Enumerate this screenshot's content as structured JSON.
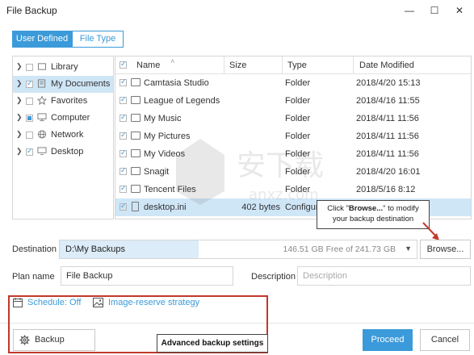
{
  "window": {
    "title": "File Backup"
  },
  "tabs": [
    {
      "label": "User Defined",
      "active": true
    },
    {
      "label": "File Type",
      "active": false
    }
  ],
  "tree": [
    {
      "label": "Library",
      "checked": false,
      "partial": false,
      "selected": false,
      "icon": "library-icon"
    },
    {
      "label": "My Documents",
      "checked": true,
      "partial": false,
      "selected": true,
      "icon": "documents-icon"
    },
    {
      "label": "Favorites",
      "checked": false,
      "partial": false,
      "selected": false,
      "icon": "star-icon"
    },
    {
      "label": "Computer",
      "checked": false,
      "partial": true,
      "selected": false,
      "icon": "computer-icon"
    },
    {
      "label": "Network",
      "checked": false,
      "partial": false,
      "selected": false,
      "icon": "network-icon"
    },
    {
      "label": "Desktop",
      "checked": true,
      "partial": false,
      "selected": false,
      "icon": "desktop-icon"
    }
  ],
  "file_list": {
    "columns": {
      "name": "Name",
      "size": "Size",
      "type": "Type",
      "date": "Date Modified"
    },
    "rows": [
      {
        "name": "Camtasia Studio",
        "size": "",
        "type": "Folder",
        "date": "2018/4/20 15:13",
        "selected": false,
        "icon": "folder-icon"
      },
      {
        "name": "League of Legends",
        "size": "",
        "type": "Folder",
        "date": "2018/4/16 11:55",
        "selected": false,
        "icon": "folder-icon"
      },
      {
        "name": "My Music",
        "size": "",
        "type": "Folder",
        "date": "2018/4/11 11:56",
        "selected": false,
        "icon": "folder-icon"
      },
      {
        "name": "My Pictures",
        "size": "",
        "type": "Folder",
        "date": "2018/4/11 11:56",
        "selected": false,
        "icon": "folder-icon"
      },
      {
        "name": "My Videos",
        "size": "",
        "type": "Folder",
        "date": "2018/4/11 11:56",
        "selected": false,
        "icon": "folder-icon"
      },
      {
        "name": "Snagit",
        "size": "",
        "type": "Folder",
        "date": "2018/4/20 16:01",
        "selected": false,
        "icon": "folder-icon"
      },
      {
        "name": "Tencent Files",
        "size": "",
        "type": "Folder",
        "date": "2018/5/16 8:12",
        "selected": false,
        "icon": "folder-icon"
      },
      {
        "name": "desktop.ini",
        "size": "402 bytes",
        "type": "Configur...",
        "date": "",
        "selected": true,
        "icon": "settings-file-icon"
      }
    ]
  },
  "callouts": {
    "browse_prefix": "Click \"",
    "browse_bold": "Browse...",
    "browse_suffix": "\" to modify",
    "browse_line2": "your backup destination",
    "advanced": "Advanced backup settings"
  },
  "destination": {
    "label": "Destination",
    "value": "D:\\My Backups",
    "free_space": "146.51 GB Free of 241.73 GB",
    "used_fraction": 0.39,
    "browse_label": "Browse..."
  },
  "plan": {
    "label": "Plan name",
    "value": "File Backup"
  },
  "description": {
    "label": "Description",
    "placeholder": "Description"
  },
  "schedule": {
    "label": "Schedule: Off"
  },
  "strategy": {
    "label": "Image-reserve strategy"
  },
  "buttons": {
    "backup_options": "Backup options",
    "proceed": "Proceed",
    "cancel": "Cancel"
  },
  "watermark": {
    "text": "安下载",
    "subtext": "anxz.com"
  },
  "colors": {
    "accent": "#3b9ad9",
    "highlight": "#cfe6f7",
    "callout_border": "#c0392b"
  }
}
